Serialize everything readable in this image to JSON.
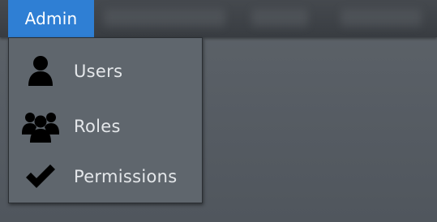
{
  "menubar": {
    "admin_label": "Admin"
  },
  "dropdown": {
    "items": [
      {
        "label": "Users",
        "icon": "user-icon"
      },
      {
        "label": "Roles",
        "icon": "group-icon"
      },
      {
        "label": "Permissions",
        "icon": "checkmark-icon"
      }
    ]
  },
  "colors": {
    "accent": "#2f7fd4",
    "menu_background": "#5f666d",
    "topbar_background": "#3e4247",
    "text": "#e4e7ea"
  }
}
